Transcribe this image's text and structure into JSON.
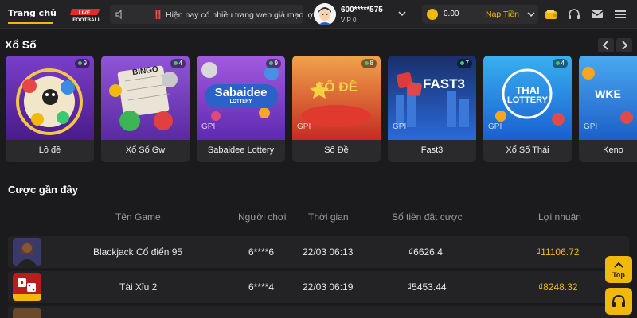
{
  "topbar": {
    "home_tab": "Trang chủ",
    "live_logo_top": "LIVE",
    "live_logo_bottom": "FOOTBALL",
    "notice_text": "‼️ Hiện nay có nhiều trang web giả mạo lợi",
    "user_name": "600*****575",
    "vip_level": "VIP 0",
    "balance": "0.00",
    "deposit_label": "Nạp Tiền"
  },
  "lottery": {
    "title": "Xổ Số",
    "cards": [
      {
        "label": "Lô đề",
        "players": "9",
        "thumb_text": "",
        "bg": "#6c2aa8"
      },
      {
        "label": "Xổ Số Gw",
        "players": "4",
        "thumb_text": "BINGO",
        "bg": "#7d3cc8"
      },
      {
        "label": "Sabaidee Lottery",
        "players": "9",
        "thumb_text": "Sabaidee",
        "thumb_sub": "LOTTERY",
        "bg": "#8a3fd0"
      },
      {
        "label": "Số Đề",
        "players": "8",
        "thumb_text": "SỐ ĐỀ",
        "bg": "#d9482b"
      },
      {
        "label": "Fast3",
        "players": "7",
        "thumb_text": "FAST3",
        "bg": "#1e6ac8"
      },
      {
        "label": "Xổ Số Thái",
        "players": "4",
        "thumb_text": "THAI",
        "thumb_sub": "LOTTERY",
        "bg": "#1f8fe0"
      },
      {
        "label": "Keno",
        "players": "",
        "thumb_text": "WKE",
        "bg": "#2e86d8"
      }
    ],
    "gpi_label": "GPI",
    "gpi_sub": "LOTTERY"
  },
  "recent": {
    "title": "Cược gần đây",
    "headers": {
      "game": "Tên Game",
      "player": "Người chơi",
      "time": "Thời gian",
      "bet": "Số tiền đặt cược",
      "profit": "Lợi nhuận"
    },
    "rows": [
      {
        "game": "Blackjack Cổ điển 95",
        "player": "6****6",
        "time": "22/03 06:13",
        "bet": "₫6626.4",
        "profit": "₫11106.72"
      },
      {
        "game": "Tài Xỉu 2",
        "player": "6****4",
        "time": "22/03 06:19",
        "bet": "₫5453.44",
        "profit": "₫8248.32"
      }
    ]
  },
  "floating": {
    "top_label": "Top"
  },
  "colors": {
    "accent": "#f0b90b",
    "background": "#1b1b1d"
  }
}
